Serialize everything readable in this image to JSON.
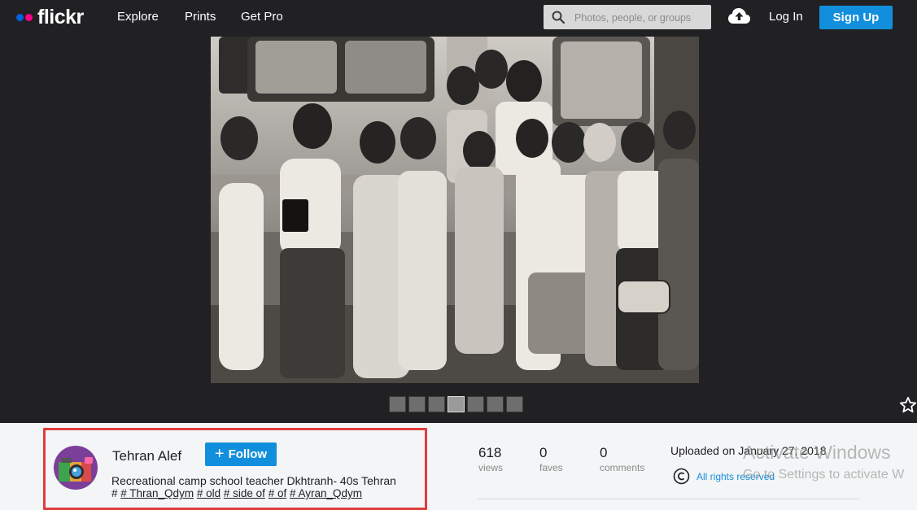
{
  "brand": {
    "name": "flickr",
    "dot_blue": "#0063dc",
    "dot_pink": "#ff0084"
  },
  "nav": {
    "explore": "Explore",
    "prints": "Prints",
    "get_pro": "Get Pro",
    "search_placeholder": "Photos, people, or groups",
    "log_in": "Log In",
    "sign_up": "Sign Up"
  },
  "colors": {
    "accent": "#128fdc",
    "topbar": "#212124",
    "highlight_box": "#e03c3c"
  },
  "photo": {
    "thumb_count": 7,
    "active_thumb": 4
  },
  "owner": {
    "name": "Tehran Alef",
    "follow_label": "Follow",
    "description": "Recreational camp school teacher Dkhtranh- 40s Tehran",
    "tags_prefix": "# ",
    "tags": [
      "# Thran_Qdym",
      "# old",
      "# side of",
      "# of",
      "# Ayran_Qdym"
    ]
  },
  "stats": {
    "views": {
      "value": "618",
      "label": "views"
    },
    "faves": {
      "value": "0",
      "label": "faves"
    },
    "comments": {
      "value": "0",
      "label": "comments"
    }
  },
  "upload": {
    "uploaded": "Uploaded on January 27, 2018",
    "rights": "All rights reserved"
  },
  "watermark": {
    "line1": "Activate Windows",
    "line2": "Go to Settings to activate W"
  }
}
